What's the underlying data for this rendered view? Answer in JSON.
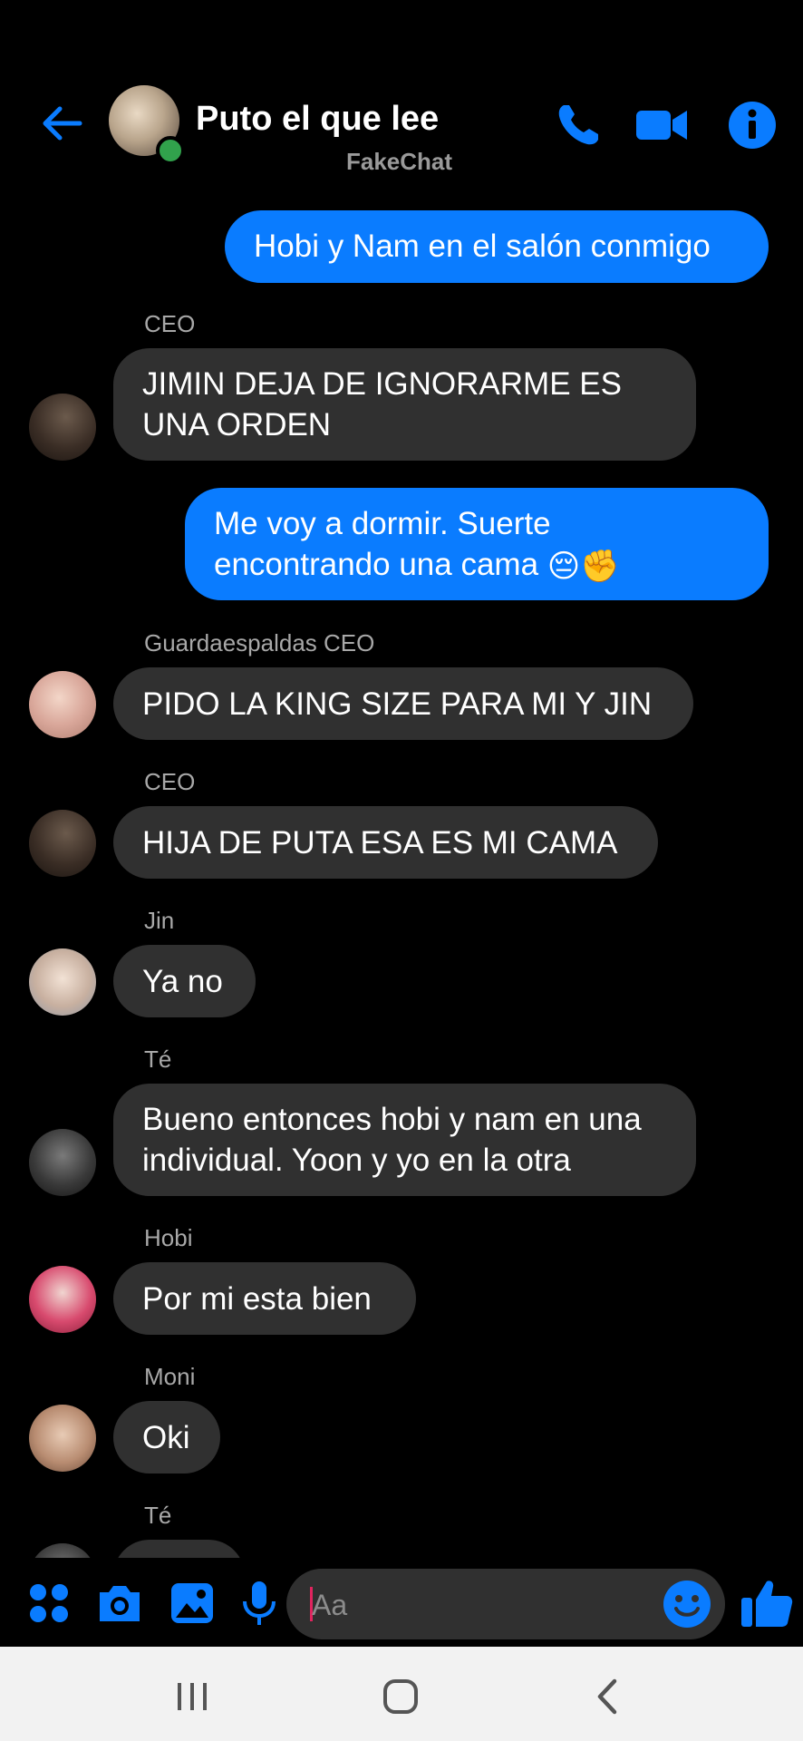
{
  "header": {
    "title": "Puto el que lee",
    "subtitle": "FakeChat",
    "accent_color": "#0a7cff",
    "icons": [
      "back-arrow-icon",
      "phone-icon",
      "video-camera-icon",
      "info-icon"
    ]
  },
  "messages": [
    {
      "direction": "out",
      "text": "Hobi y Nam en el salón conmigo"
    },
    {
      "direction": "in",
      "sender": "CEO",
      "lines": [
        "JIMIN DEJA DE IGNORARME ES",
        "UNA ORDEN"
      ]
    },
    {
      "direction": "out",
      "lines": [
        "Me voy a dormir. Suerte",
        "encontrando una cama"
      ],
      "emoji": "😔✊"
    },
    {
      "direction": "in",
      "sender": "Guardaespaldas CEO",
      "text": "PIDO LA KING SIZE PARA MI Y JIN"
    },
    {
      "direction": "in",
      "sender": "CEO",
      "text": "HIJA DE PUTA ESA ES MI CAMA"
    },
    {
      "direction": "in",
      "sender": "Jin",
      "text": "Ya no"
    },
    {
      "direction": "in",
      "sender": "Té",
      "lines": [
        "Bueno entonces hobi y nam en una",
        "individual. Yoon y yo en la otra"
      ]
    },
    {
      "direction": "in",
      "sender": "Hobi",
      "text": "Por mi esta bien"
    },
    {
      "direction": "in",
      "sender": "Moni",
      "text": "Oki"
    },
    {
      "direction": "in",
      "sender": "Té",
      "text": ""
    }
  ],
  "composer": {
    "placeholder": "Aa",
    "value": "",
    "icons": [
      "apps-icon",
      "camera-icon",
      "gallery-icon",
      "microphone-icon",
      "emoji-icon",
      "thumbs-up-icon"
    ]
  },
  "navbar": {
    "icons": [
      "recent-apps-icon",
      "home-icon",
      "back-icon"
    ]
  }
}
